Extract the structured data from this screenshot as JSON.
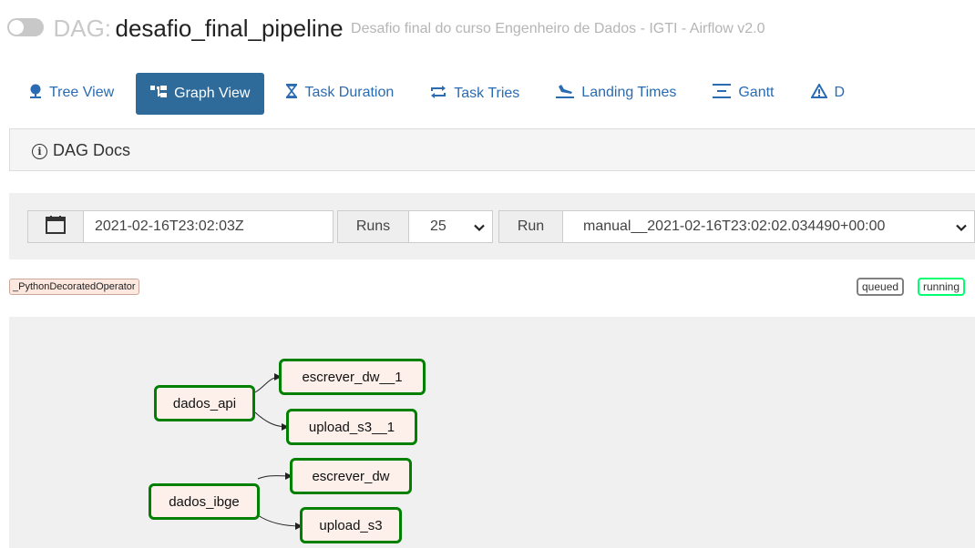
{
  "header": {
    "prefix": "DAG:",
    "dag_id": "desafio_final_pipeline",
    "description": "Desafio final do curso Engenheiro de Dados - IGTI - Airflow v2.0"
  },
  "nav": {
    "tabs": [
      {
        "label": "Tree View",
        "icon": "tree-icon"
      },
      {
        "label": "Graph View",
        "icon": "graph-icon",
        "active": true
      },
      {
        "label": "Task Duration",
        "icon": "hourglass-icon"
      },
      {
        "label": "Task Tries",
        "icon": "retry-icon"
      },
      {
        "label": "Landing Times",
        "icon": "landing-icon"
      },
      {
        "label": "Gantt",
        "icon": "gantt-icon"
      },
      {
        "label": "D",
        "icon": "warning-icon"
      }
    ]
  },
  "docs": {
    "label": "DAG Docs"
  },
  "form": {
    "execution_date": "2021-02-16T23:02:03Z",
    "runs_label": "Runs",
    "runs_value": "25",
    "run_label": "Run",
    "run_value": "manual__2021-02-16T23:02:02.034490+00:00"
  },
  "legend": {
    "operator": "_PythonDecoratedOperator",
    "states": [
      "queued",
      "running"
    ],
    "colors": {
      "queued": "#808080",
      "running": "#01ff70",
      "success": "#008000",
      "operator_bg": "#fde8e0"
    }
  },
  "graph": {
    "nodes": [
      "dados_api",
      "escrever_dw__1",
      "upload_s3__1",
      "dados_ibge",
      "escrever_dw",
      "upload_s3"
    ]
  }
}
